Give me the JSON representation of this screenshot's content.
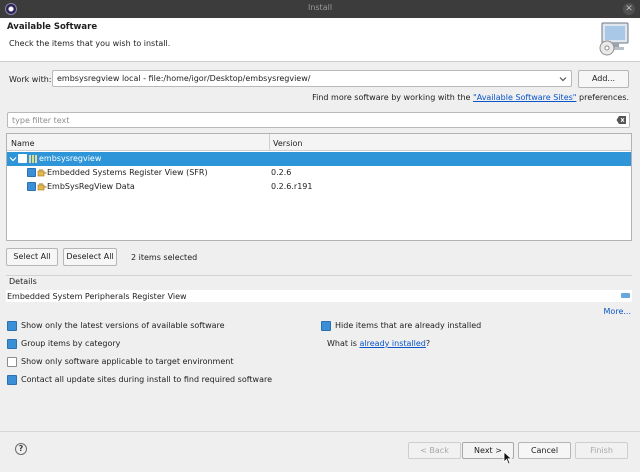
{
  "window": {
    "title": "Install"
  },
  "header": {
    "title": "Available Software",
    "subtitle": "Check the items that you wish to install."
  },
  "work_with": {
    "label": "Work with:",
    "value": "embsysregview local - file:/home/igor/Desktop/embsysregview/",
    "add_label": "Add...",
    "more_prefix": "Find more software by working with the ",
    "more_link": "\"Available Software Sites\"",
    "more_suffix": " preferences."
  },
  "filter": {
    "placeholder": "type filter text"
  },
  "table": {
    "columns": [
      "Name",
      "Version"
    ],
    "rows": [
      {
        "name": "embsysregview",
        "version": ""
      },
      {
        "name": "Embedded Systems Register View (SFR)",
        "version": "0.2.6"
      },
      {
        "name": "EmbSysRegView Data",
        "version": "0.2.6.r191"
      }
    ]
  },
  "selection": {
    "select_all": "Select All",
    "deselect_all": "Deselect All",
    "count": "2 items selected"
  },
  "details": {
    "label": "Details",
    "text": "Embedded System Peripherals Register View",
    "more": "More..."
  },
  "options": {
    "latest_only": "Show only the latest versions of available software",
    "hide_installed": "Hide items that are already installed",
    "group_category": "Group items by category",
    "installed_prefix": "What is ",
    "installed_link": "already installed",
    "installed_suffix": "?",
    "target_env": "Show only software applicable to target environment",
    "contact_sites": "Contact all update sites during install to find required software"
  },
  "footer": {
    "back": "< Back",
    "next": "Next >",
    "cancel": "Cancel",
    "finish": "Finish"
  },
  "colors": {
    "selection": "#2d95d8",
    "link": "#0a55c8",
    "checkbox_on": "#3a8fd6"
  }
}
